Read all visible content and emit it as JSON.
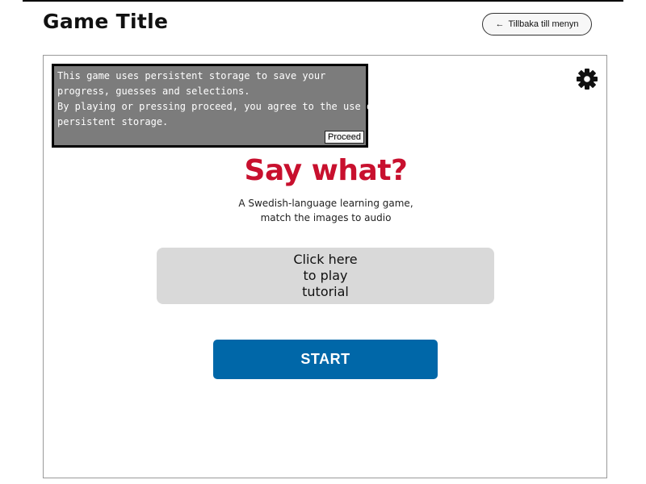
{
  "header": {
    "title": "Game Title",
    "back_button": {
      "icon": "left-arrow-icon",
      "label": "Tillbaka till menyn"
    }
  },
  "notice": {
    "lines": [
      "This game uses persistent storage to save your",
      "progress, guesses and selections.",
      "By playing or pressing proceed, you agree to the use of",
      "persistent storage."
    ],
    "proceed_label": "Proceed"
  },
  "settings": {
    "icon": "gear-icon"
  },
  "game": {
    "name": "Say what?",
    "description_lines": [
      "A Swedish-language learning game,",
      "match the images to audio"
    ],
    "tutorial_lines": [
      "Click here",
      "to play",
      "tutorial"
    ],
    "start_label": "START"
  },
  "colors": {
    "title_red": "#c8102e",
    "start_blue": "#0067a8",
    "tutorial_gray": "#d9d9d9",
    "notice_gray": "#7c7c7c"
  }
}
